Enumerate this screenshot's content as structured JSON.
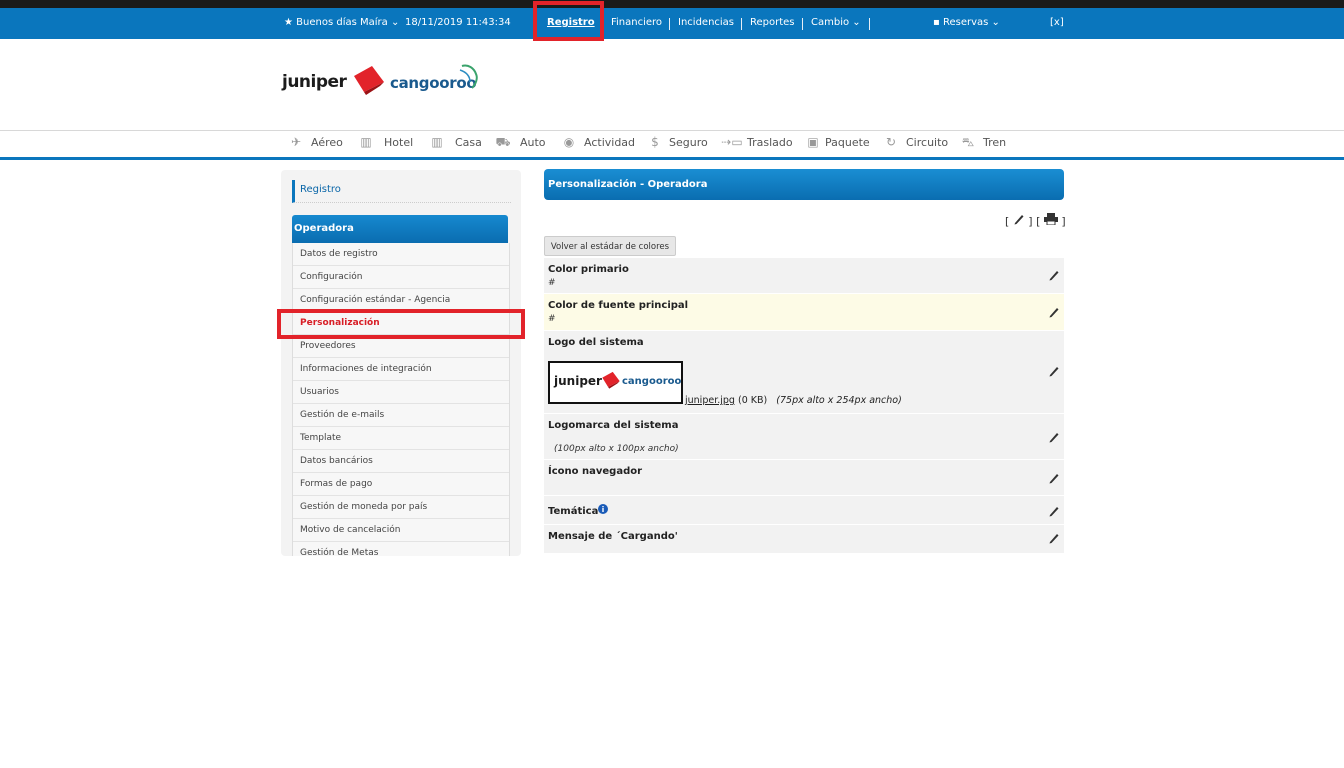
{
  "topbar": {
    "greeting": "Buenos días Maíra",
    "datetime": "18/11/2019 11:43:34",
    "menu": [
      "Registro",
      "Financiero",
      "Incidencias",
      "Reportes",
      "Cambio"
    ],
    "reservas": "Reservas",
    "close": "[x]"
  },
  "brand": {
    "left": "juniper",
    "right": "cangooroo"
  },
  "products": [
    "Aéreo",
    "Hotel",
    "Casa",
    "Auto",
    "Actividad",
    "Seguro",
    "Traslado",
    "Paquete",
    "Circuito",
    "Tren"
  ],
  "sidebar": {
    "section": "Registro",
    "header": "Operadora",
    "items": [
      "Datos de registro",
      "Configuración",
      "Configuración estándar - Agencia",
      "Personalización",
      "Proveedores",
      "Informaciones de integración",
      "Usuarios",
      "Gestión de e-mails",
      "Template",
      "Datos bancários",
      "Formas de pago",
      "Gestión de moneda por país",
      "Motivo de cancelación",
      "Gestión de Metas"
    ],
    "selected_index": 3
  },
  "main": {
    "title": "Personalización - Operadora",
    "reset_button": "Volver al estádar de colores",
    "rows": {
      "primary_color": {
        "label": "Color primario",
        "value": "#"
      },
      "font_color": {
        "label": "Color de fuente principal",
        "value": "#"
      },
      "system_logo": {
        "label": "Logo del sistema",
        "file": "juniper.jpg",
        "size": "(0 KB)",
        "dims": "(75px alto x 254px ancho)"
      },
      "logomark": {
        "label": "Logomarca del sistema",
        "dims": "(100px alto x 100px ancho)"
      },
      "browser_icon": {
        "label": "Ícono navegador"
      },
      "theme": {
        "label": "Temática"
      },
      "loading_msg": {
        "label": "Mensaje de ´Cargando'"
      }
    }
  },
  "colors": {
    "primary": "#0a76bd",
    "highlight": "#e2232a",
    "selected_text": "#d81e26"
  }
}
